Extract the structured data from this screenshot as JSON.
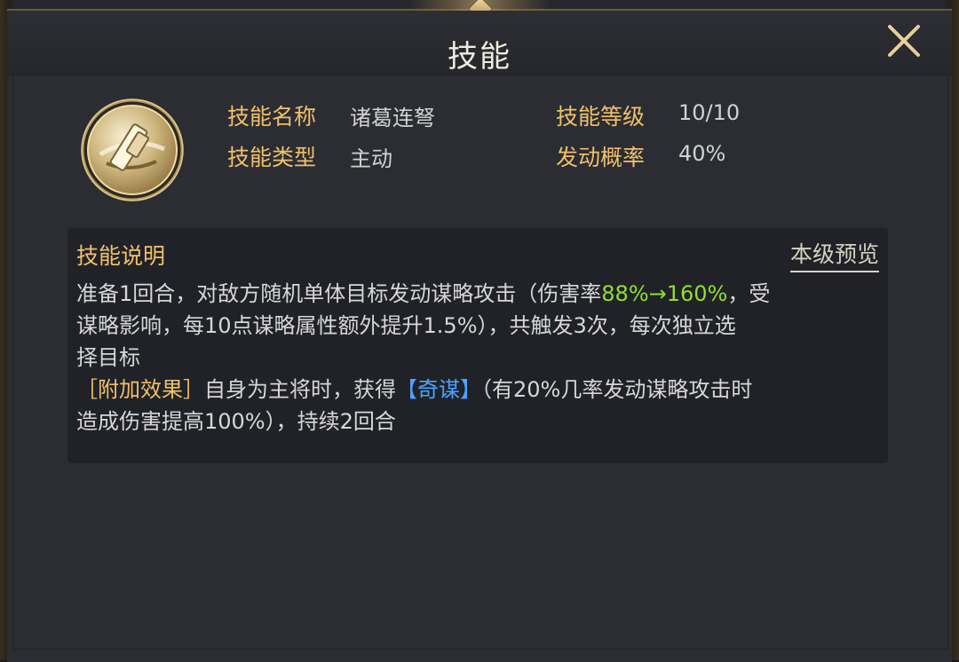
{
  "window": {
    "title": "技能"
  },
  "skill": {
    "name_label": "技能名称",
    "name": "诸葛连弩",
    "type_label": "技能类型",
    "type": "主动",
    "level_label": "技能等级",
    "level": "10/10",
    "chance_label": "发动概率",
    "chance": "40%"
  },
  "description": {
    "title": "技能说明",
    "preview_label": "本级预览",
    "line1_prefix": "准备1回合，对敌方随机单体目标发动谋略攻击（伤害率",
    "damage_range": "88%→160%",
    "line1_suffix": "，受",
    "line2": "谋略影响，每10点谋略属性额外提升1.5%），共触发3次，每次独立选",
    "line3": "择目标",
    "bonus_tag": "［附加效果］",
    "bonus_text_1": "自身为主将时，获得",
    "bonus_status": "【奇谋】",
    "bonus_text_2": "（有20%几率发动谋略攻击时",
    "bonus_text_3": "造成伤害提高100%），持续2回合"
  },
  "colors": {
    "label_gold": "#f0c06b",
    "highlight_green": "#90df31",
    "status_blue": "#4da2ff",
    "text_light": "#d7d7d7"
  },
  "icons": {
    "close": "close-icon",
    "skill": "crossbow-skill-icon"
  }
}
